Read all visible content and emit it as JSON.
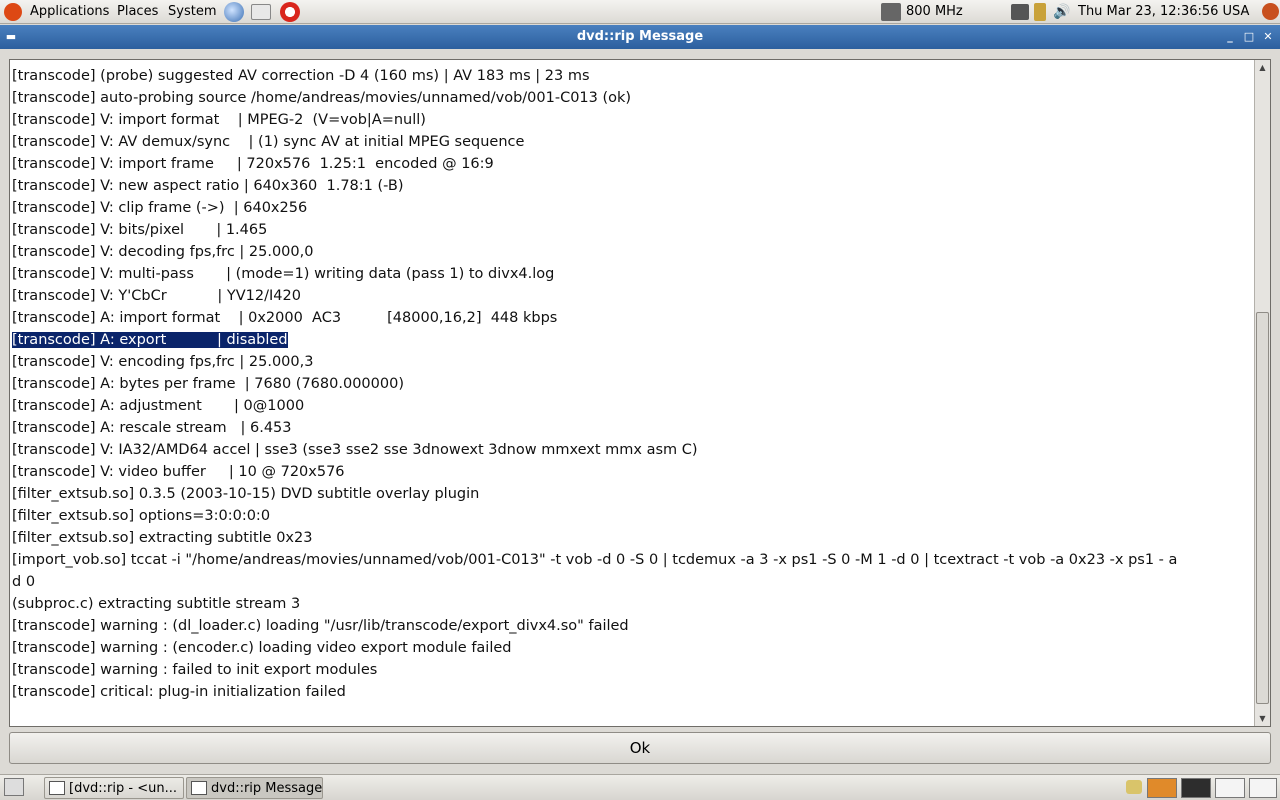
{
  "top_panel": {
    "menus": [
      "Applications",
      "Places",
      "System"
    ],
    "cpu_freq": "800 MHz",
    "clock": "Thu Mar 23, 12:36:56 USA"
  },
  "window": {
    "title": "dvd::rip Message",
    "log_lines": [
      "[transcode] (probe) suggested AV correction -D 4 (160 ms) | AV 183 ms | 23 ms",
      "[transcode] auto-probing source /home/andreas/movies/unnamed/vob/001-C013 (ok)",
      "[transcode] V: import format    | MPEG-2  (V=vob|A=null)",
      "[transcode] V: AV demux/sync    | (1) sync AV at initial MPEG sequence",
      "[transcode] V: import frame     | 720x576  1.25:1  encoded @ 16:9",
      "[transcode] V: new aspect ratio | 640x360  1.78:1 (-B)",
      "[transcode] V: clip frame (->)  | 640x256",
      "[transcode] V: bits/pixel       | 1.465",
      "[transcode] V: decoding fps,frc | 25.000,0",
      "[transcode] V: multi-pass       | (mode=1) writing data (pass 1) to divx4.log",
      "[transcode] V: Y'CbCr           | YV12/I420",
      "[transcode] A: import format    | 0x2000  AC3          [48000,16,2]  448 kbps",
      "[transcode] A: export           | disabled",
      "[transcode] V: encoding fps,frc | 25.000,3",
      "[transcode] A: bytes per frame  | 7680 (7680.000000)",
      "[transcode] A: adjustment       | 0@1000",
      "[transcode] A: rescale stream   | 6.453",
      "[transcode] V: IA32/AMD64 accel | sse3 (sse3 sse2 sse 3dnowext 3dnow mmxext mmx asm C)",
      "[transcode] V: video buffer     | 10 @ 720x576",
      "[filter_extsub.so] 0.3.5 (2003-10-15) DVD subtitle overlay plugin",
      "[filter_extsub.so] options=3:0:0:0:0",
      "[filter_extsub.so] extracting subtitle 0x23",
      "[import_vob.so] tccat -i \"/home/andreas/movies/unnamed/vob/001-C013\" -t vob -d 0 -S 0 | tcdemux -a 3 -x ps1 -S 0 -M 1 -d 0 | tcextract -t vob -a 0x23 -x ps1 - a",
      "d 0",
      "(subproc.c) extracting subtitle stream 3",
      "[transcode] warning : (dl_loader.c) loading \"/usr/lib/transcode/export_divx4.so\" failed",
      "[transcode] warning : (encoder.c) loading video export module failed",
      "[transcode] warning : failed to init export modules",
      "[transcode] critical: plug-in initialization failed"
    ],
    "selected_line_index": 12,
    "ok_label": "Ok"
  },
  "taskbar": {
    "tasks": [
      "[dvd::rip - <un...",
      "dvd::rip Message"
    ]
  }
}
